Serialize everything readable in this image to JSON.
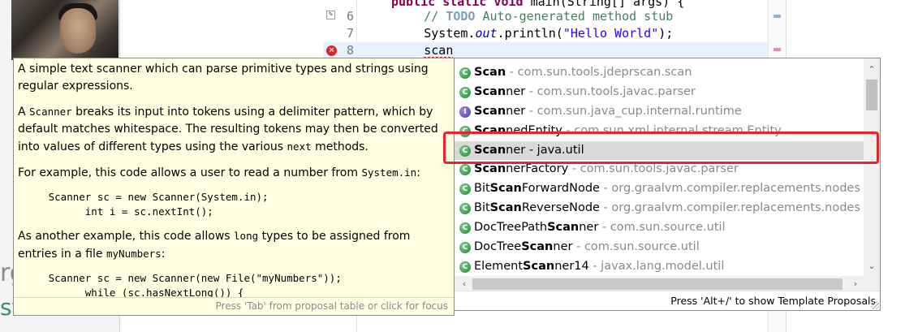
{
  "editor": {
    "lines": [
      {
        "no": "6",
        "parts": [
          {
            "t": "        ",
            "c": ""
          },
          {
            "t": "// ",
            "c": "cmt"
          },
          {
            "t": "TODO",
            "c": "cmt-todo"
          },
          {
            "t": " Auto-generated method stub",
            "c": "cmt"
          }
        ]
      },
      {
        "no": "7",
        "parts": [
          {
            "t": "        System.",
            "c": ""
          },
          {
            "t": "out",
            "c": "fld"
          },
          {
            "t": ".println(",
            "c": ""
          },
          {
            "t": "\"Hello World\"",
            "c": "str"
          },
          {
            "t": ");",
            "c": ""
          }
        ]
      },
      {
        "no": "8",
        "parts": [
          {
            "t": "        scan",
            "c": ""
          }
        ]
      }
    ],
    "top_partial": {
      "kw": "public static void",
      "rest": " main(String[] args) {"
    }
  },
  "background": {
    "left_text_1": "rg",
    "left_text_2": "stub"
  },
  "javadoc": {
    "para1": "A simple text scanner which can parse primitive types and strings using regular expressions.",
    "para2_a": "A ",
    "para2_code1": "Scanner",
    "para2_b": " breaks its input into tokens using a delimiter pattern, which by default matches whitespace. The resulting tokens may then be converted into values of different types using the various ",
    "para2_code2": "next",
    "para2_c": " methods.",
    "para3_a": "For example, this code allows a user to read a number from ",
    "para3_code": "System.in",
    "para3_b": ":",
    "code1": "     Scanner sc = new Scanner(System.in);\n           int i = sc.nextInt();",
    "para4_a": "As another example, this code allows ",
    "para4_code1": "long",
    "para4_b": " types to be assigned from entries in a file ",
    "para4_code2": "myNumbers",
    "para4_c": ":",
    "code2": "     Scanner sc = new Scanner(new File(\"myNumbers\"));\n           while (sc.hasNextLong()) {",
    "footer": "Press 'Tab' from proposal table or click for focus"
  },
  "proposals": {
    "items": [
      {
        "icon": "class",
        "pre": "",
        "bold": "Scan",
        "post": "",
        "pkg": " - com.sun.tools.jdeprscan.scan"
      },
      {
        "icon": "class",
        "pre": "",
        "bold": "Scan",
        "post": "ner",
        "pkg": " - com.sun.tools.javac.parser"
      },
      {
        "icon": "interface",
        "pre": "",
        "bold": "Scan",
        "post": "ner",
        "pkg": " - com.sun.java_cup.internal.runtime"
      },
      {
        "icon": "class",
        "pre": "",
        "bold": "Scan",
        "post": "nedEntity",
        "pkg": " - com.sun.xml.internal.stream.Entity"
      },
      {
        "icon": "class",
        "pre": "",
        "bold": "Scan",
        "post": "ner - java.util",
        "pkg": "",
        "selected": true
      },
      {
        "icon": "class",
        "pre": "",
        "bold": "Scan",
        "post": "nerFactory",
        "pkg": " - com.sun.tools.javac.parser"
      },
      {
        "icon": "class",
        "pre": "Bit",
        "bold": "Scan",
        "post": "ForwardNode",
        "pkg": " - org.graalvm.compiler.replacements.nodes"
      },
      {
        "icon": "class",
        "pre": "Bit",
        "bold": "Scan",
        "post": "ReverseNode",
        "pkg": " - org.graalvm.compiler.replacements.nodes"
      },
      {
        "icon": "class",
        "pre": "DocTreePath",
        "bold": "Scan",
        "post": "ner",
        "pkg": " - com.sun.source.util"
      },
      {
        "icon": "class",
        "pre": "DocTree",
        "bold": "Scan",
        "post": "ner",
        "pkg": " - com.sun.source.util"
      },
      {
        "icon": "class",
        "pre": "Element",
        "bold": "Scan",
        "post": "ner14",
        "pkg": " - javax.lang.model.util"
      }
    ],
    "footer": "Press 'Alt+/' to show Template Proposals"
  },
  "colors": {
    "highlight": "#e8232c",
    "tooltip_bg": "#ffffe1",
    "selected_row": "#d9d9d9",
    "keyword": "#7f0055",
    "string": "#2a00ff",
    "comment": "#3f7f5f"
  }
}
